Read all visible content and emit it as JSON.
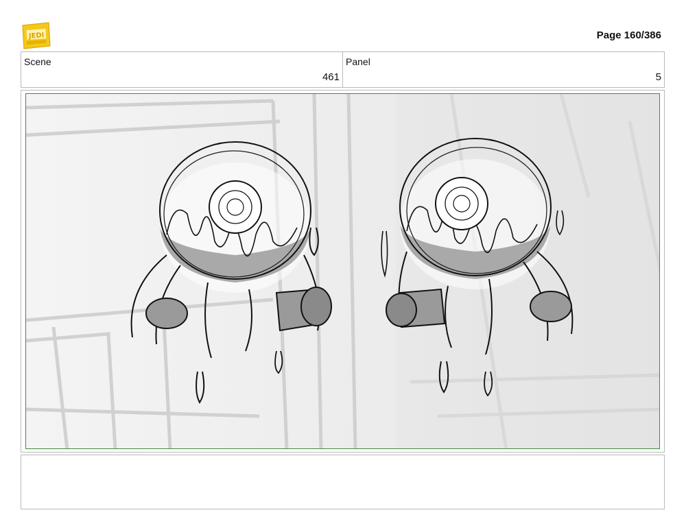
{
  "header": {
    "logo_name": "young-jedi-adventures-logo",
    "page_label": "Page 160/386"
  },
  "info_table": {
    "scene_label": "Scene",
    "scene_value": "461",
    "panel_label": "Panel",
    "panel_value": "5"
  },
  "panel": {
    "description": "Two round domed droids with drippy goo, side by side, sketched in pencil"
  },
  "notes": {
    "text": ""
  },
  "colors": {
    "frame_border": "#b9b9b9",
    "panel_border": "#3e8a3e",
    "logo_yellow": "#f2c21b"
  }
}
